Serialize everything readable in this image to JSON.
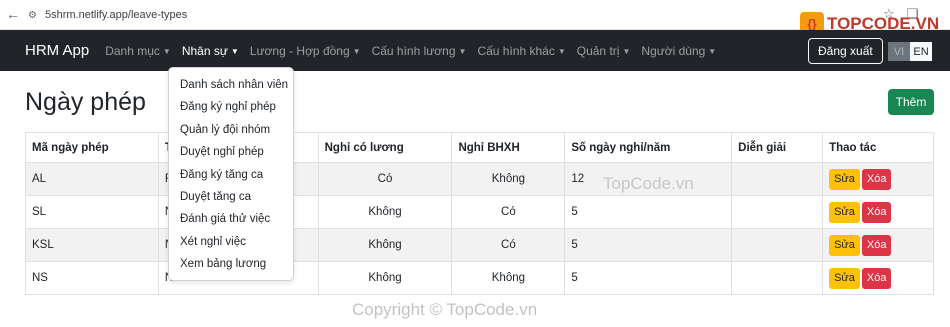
{
  "browser": {
    "url": "5shrm.netlify.app/leave-types"
  },
  "navbar": {
    "brand": "HRM App",
    "items": [
      {
        "label": "Danh mục"
      },
      {
        "label": "Nhân sự"
      },
      {
        "label": "Lương - Hợp đồng"
      },
      {
        "label": "Cấu hình lương"
      },
      {
        "label": "Cấu hình khác"
      },
      {
        "label": "Quản trị"
      },
      {
        "label": "Người dùng"
      }
    ],
    "logout": "Đăng xuất",
    "lang_vi": "VI",
    "lang_en": "EN"
  },
  "dropdown": {
    "items": [
      "Danh sách nhân viên",
      "Đăng ký nghỉ phép",
      "Quản lý đội nhóm",
      "Duyệt nghỉ phép",
      "Đăng ký tăng ca",
      "Duyệt tăng ca",
      "Đánh giá thử việc",
      "Xét nghỉ việc",
      "Xem bảng lương"
    ]
  },
  "page": {
    "title": "Ngày phép",
    "add_button": "Thêm"
  },
  "table": {
    "headers": [
      "Mã ngày phép",
      "T",
      "Nghỉ có lương",
      "Nghỉ BHXH",
      "Số ngày nghỉ/năm",
      "Diễn giải",
      "Thao tác"
    ],
    "rows": [
      {
        "code": "AL",
        "name": "F",
        "paid": "Có",
        "bhxh": "Không",
        "days": "12",
        "desc": ""
      },
      {
        "code": "SL",
        "name": "N",
        "paid": "Không",
        "bhxh": "Có",
        "days": "5",
        "desc": ""
      },
      {
        "code": "KSL",
        "name": "N",
        "paid": "Không",
        "bhxh": "Có",
        "days": "5",
        "desc": ""
      },
      {
        "code": "NS",
        "name": "N",
        "paid": "Không",
        "bhxh": "Không",
        "days": "5",
        "desc": ""
      }
    ],
    "edit_label": "Sửa",
    "delete_label": "Xóa"
  },
  "logo": {
    "text": "TOPCODE.VN"
  },
  "watermark": {
    "center": "TopCode.vn",
    "bottom": "Copyright © TopCode.vn"
  },
  "colors": {
    "navbar_bg": "#212529",
    "success": "#198754",
    "warning": "#ffc107",
    "danger": "#dc3545"
  }
}
